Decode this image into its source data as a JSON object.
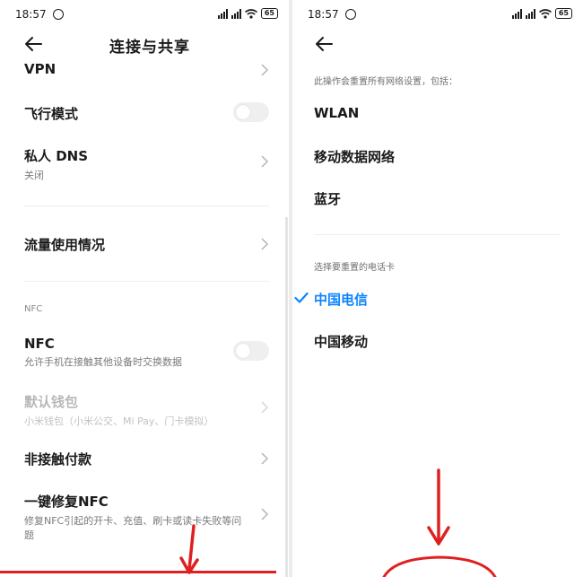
{
  "left": {
    "status_time": "18:57",
    "battery": "65",
    "title": "连接与共享",
    "items": [
      {
        "label": "VPN"
      },
      {
        "label": "飞行模式"
      },
      {
        "label": "私人 DNS",
        "sub": "关闭"
      },
      {
        "label": "流量使用情况"
      },
      {
        "label": "NFC",
        "sub": "允许手机在接触其他设备时交换数据"
      },
      {
        "label": "默认钱包",
        "sub": "小米钱包（小米公交、Mi Pay、门卡模拟）"
      },
      {
        "label": "非接触付款"
      },
      {
        "label": "一键修复NFC",
        "sub_line1": "修复NFC引起的开卡、充值、刷卡或读卡失败等问",
        "sub_line2": "题"
      }
    ],
    "section_nfc": "NFC"
  },
  "right": {
    "status_time": "18:57",
    "battery": "65",
    "note": "此操作会重置所有网络设置，包括：",
    "items": [
      "WLAN",
      "移动数据网络",
      "蓝牙"
    ],
    "sim_section": "选择要重置的电话卡",
    "sims": [
      {
        "label": "中国电信",
        "selected": true
      },
      {
        "label": "中国移动",
        "selected": false
      }
    ]
  },
  "colors": {
    "accent": "#0d84ff",
    "annotation": "#e02020"
  }
}
